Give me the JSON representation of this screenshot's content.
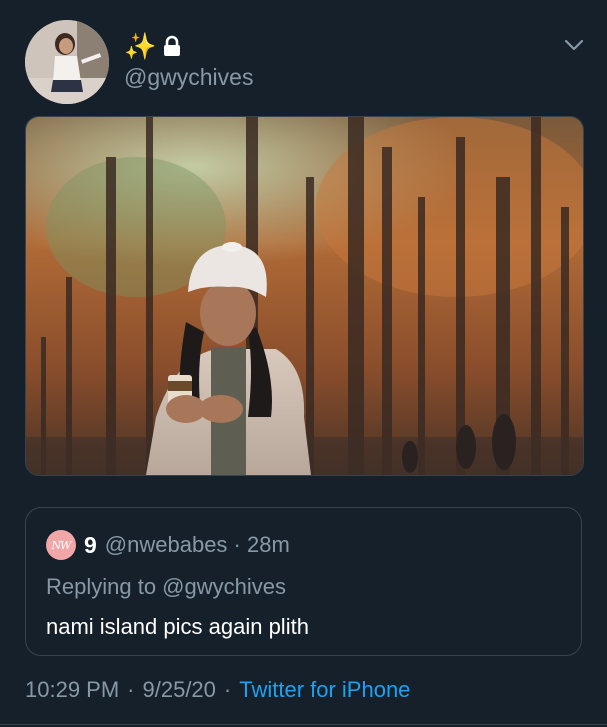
{
  "tweet": {
    "display_name_icons": [
      "sparkles-icon",
      "lock-icon"
    ],
    "sparkles_glyph": "✨",
    "handle": "@gwychives",
    "menu_icon": "chevron-down-icon"
  },
  "quoted_tweet": {
    "avatar_text": "NW",
    "name": "9",
    "handle_time": "@nwebabes · 28m",
    "replying": "Replying to @gwychives",
    "text": "nami island pics again plith"
  },
  "meta": {
    "time": "10:29 PM",
    "sep1": "·",
    "date": "9/25/20",
    "sep2": "·",
    "source": "Twitter for iPhone"
  },
  "colors": {
    "background": "#15202b",
    "secondary_text": "#8899a6",
    "link": "#1da1f2",
    "border": "#38444d"
  }
}
